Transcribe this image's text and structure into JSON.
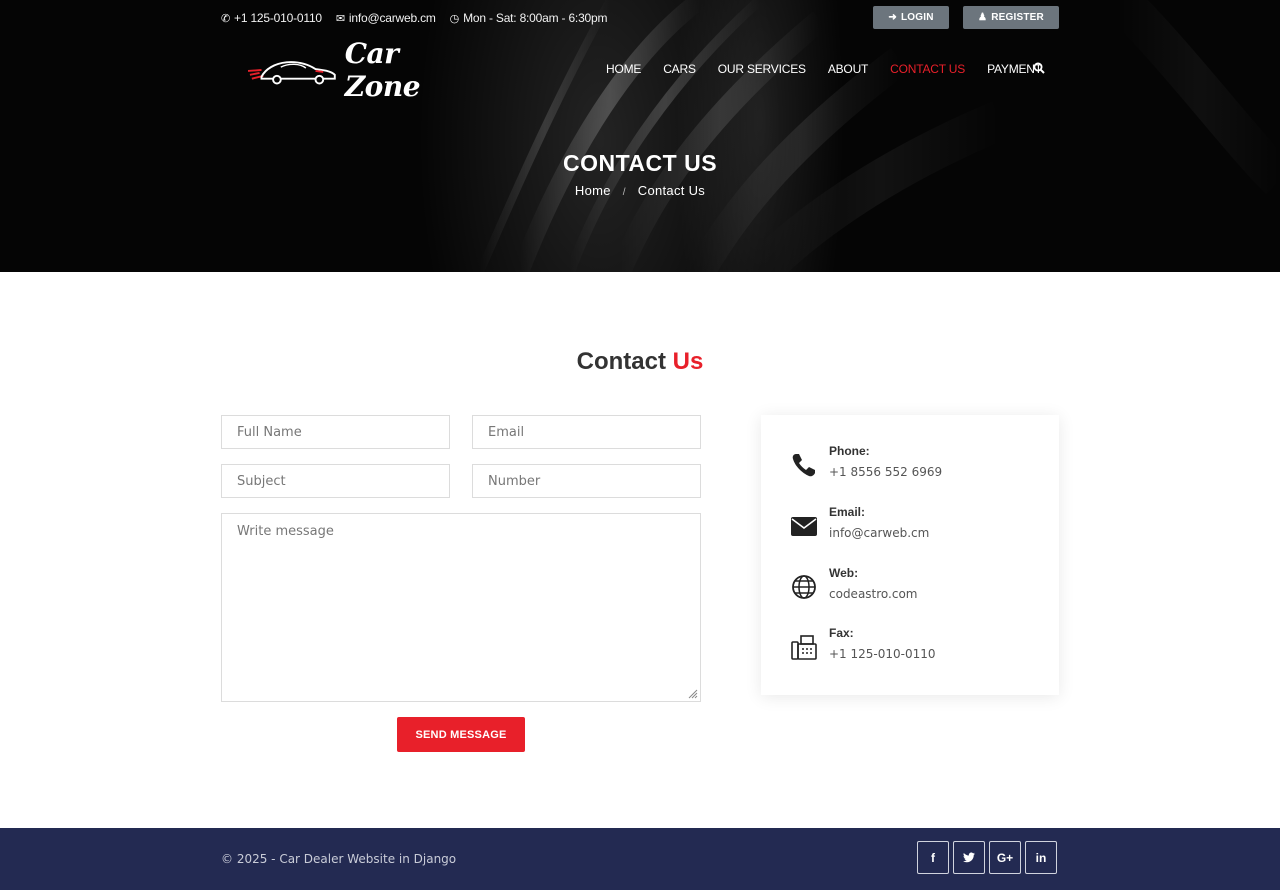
{
  "topbar": {
    "phone": "+1 125-010-0110",
    "email": "info@carweb.cm",
    "hours": "Mon - Sat: 8:00am - 6:30pm"
  },
  "auth": {
    "login": "LOGIN",
    "register": "REGISTER"
  },
  "brand": "Car Zone",
  "nav": {
    "items": [
      "HOME",
      "CARS",
      "OUR SERVICES",
      "ABOUT",
      "CONTACT US",
      "PAYMENT"
    ],
    "active": "CONTACT US"
  },
  "hero": {
    "title": "CONTACT US",
    "breadcrumb": [
      "Home",
      "Contact Us"
    ]
  },
  "section": {
    "title_main": "Contact",
    "title_accent": "Us"
  },
  "form": {
    "full_name_placeholder": "Full Name",
    "email_placeholder": "Email",
    "subject_placeholder": "Subject",
    "number_placeholder": "Number",
    "message_placeholder": "Write message",
    "submit_label": "SEND MESSAGE"
  },
  "contact_info": [
    {
      "label": "Phone:",
      "value": "+1 8556 552 6969",
      "icon": "phone-icon"
    },
    {
      "label": "Email:",
      "value": "info@carweb.cm",
      "icon": "envelope-icon"
    },
    {
      "label": "Web:",
      "value": "codeastro.com",
      "icon": "globe-icon"
    },
    {
      "label": "Fax:",
      "value": "+1 125-010-0110",
      "icon": "fax-icon"
    }
  ],
  "footer": {
    "copyright": "© 2025 - Car Dealer Website in Django",
    "social": [
      "f",
      "twitter",
      "G+",
      "in"
    ]
  },
  "colors": {
    "accent": "#e8202a",
    "footer": "#232a52",
    "button_gray": "#6c757d"
  }
}
